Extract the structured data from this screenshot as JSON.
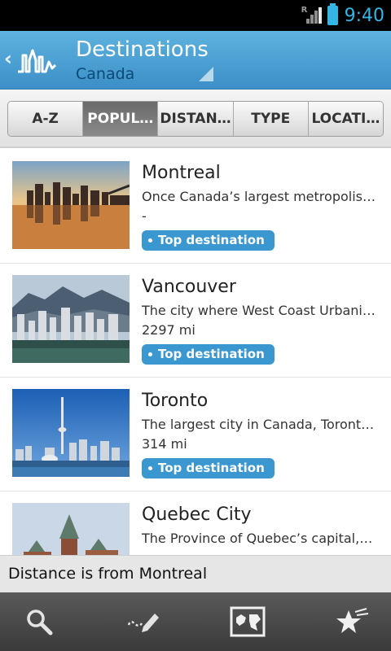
{
  "status_bar": {
    "time": "9:40",
    "roaming_indicator": "R",
    "icons": [
      "signal-icon",
      "battery-icon"
    ]
  },
  "header": {
    "title": "Destinations",
    "subtitle": "Canada",
    "back_icon": "chevron-left-icon",
    "logo_icon": "skyline-logo-icon",
    "colors": {
      "header_top": "#5fb3e0",
      "header_bottom": "#3b8fc6",
      "subtitle": "#0b4a78"
    }
  },
  "filter_tabs": [
    {
      "label": "A-Z",
      "active": false
    },
    {
      "label": "POPUL…",
      "active": true
    },
    {
      "label": "DISTAN…",
      "active": false
    },
    {
      "label": "TYPE",
      "active": false
    },
    {
      "label": "LOCATI…",
      "active": false
    }
  ],
  "destinations": [
    {
      "name": "Montreal",
      "description": "Once Canada’s largest metropolis,…",
      "distance": "-",
      "badge": "Top destination",
      "thumbnail": "montreal-skyline-reflection"
    },
    {
      "name": "Vancouver",
      "description": "The city where West Coast Urbanis…",
      "distance": "2297 mi",
      "badge": "Top destination",
      "thumbnail": "vancouver-mountains-city"
    },
    {
      "name": "Toronto",
      "description": "The largest city in Canada, Toronto…",
      "distance": "314 mi",
      "badge": "Top destination",
      "thumbnail": "toronto-cn-tower-skyline"
    },
    {
      "name": "Quebec City",
      "description": "The Province of Quebec’s capital,…",
      "distance": "",
      "badge": "",
      "thumbnail": "quebec-chateau-frontenac"
    }
  ],
  "toast": {
    "text": "Distance is from Montreal"
  },
  "bottom_bar": {
    "items": [
      "search-icon",
      "draw-route-icon",
      "map-icon",
      "favorites-star-icon"
    ]
  },
  "colors": {
    "accent": "#33b5e5",
    "badge": "#3a97cf",
    "active_tab": "#6a6a6a"
  }
}
